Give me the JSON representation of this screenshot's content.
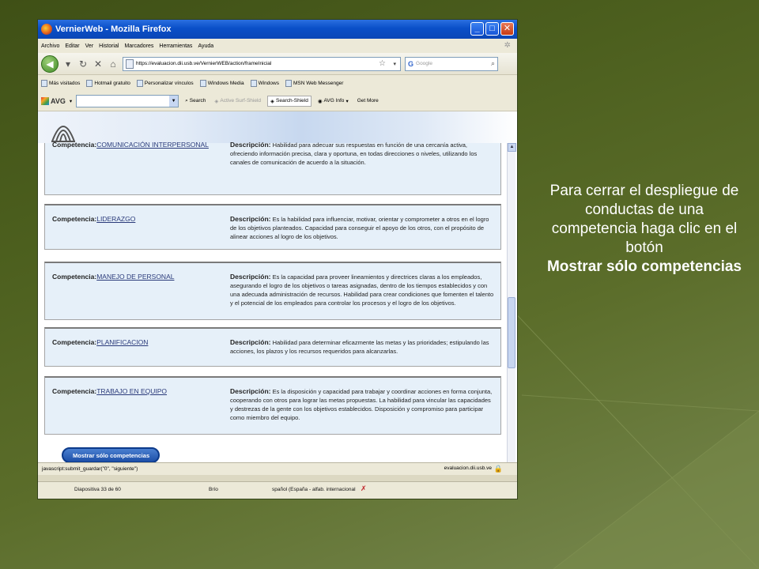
{
  "browser": {
    "title": "VernierWeb - Mozilla Firefox",
    "window_buttons": [
      "_",
      "□",
      "✕"
    ],
    "menu": [
      "Archivo",
      "Editar",
      "Ver",
      "Historial",
      "Marcadores",
      "Herramientas",
      "Ayuda"
    ],
    "url": "https://evaluacion.dii.usb.ve/VernierWEB/action/frameInicial",
    "search_placeholder": "Google",
    "bookmarks": [
      "Más visitados",
      "Hotmail gratuito",
      "Personalizar vínculos",
      "Windows Media",
      "Windows",
      "MSN Web Messenger"
    ],
    "toolbar": {
      "avg_label": "AVG",
      "search_label": "Search",
      "active_surf_label": "Active Surf-Shield",
      "search_shield_label": "Search-Shield",
      "avg_info_label": "AVG Info",
      "get_more_label": "Get More"
    },
    "status_text": "javascript:submit_guardar(\"0\", \"siguiente\")",
    "status_domain": "evaluacion.dii.usb.ve"
  },
  "page": {
    "competency_label": "Competencia:",
    "description_label": "Descripción:",
    "competencies": [
      {
        "name": "COMUNICACIÓN INTERPERSONAL",
        "description": "Habilidad para adecuar sus respuestas en función de una cercanía activa, ofreciendo información precisa, clara y oportuna, en todas direcciones o niveles, utilizando los canales de comunicación de acuerdo a la situación."
      },
      {
        "name": "LIDERAZGO",
        "description": "Es la habilidad para influenciar, motivar, orientar y comprometer a otros en el logro de los objetivos planteados. Capacidad para conseguir el apoyo de los otros, con el propósito de alinear acciones al logro de los objetivos."
      },
      {
        "name": "MANEJO DE PERSONAL",
        "description": "Es la capacidad para proveer lineamientos y directrices claras a los empleados, asegurando el logro de los objetivos o tareas asignadas, dentro de los tiempos establecidos y con una adecuada administración de recursos. Habilidad para crear condiciones que fomenten el talento y el potencial de los empleados para controlar los procesos y el logro de los objetivos."
      },
      {
        "name": "PLANIFICACION",
        "description": "Habilidad para determinar eficazmente las metas y las prioridades; estipulando las acciones, los plazos y los recursos requeridos para alcanzarlas."
      },
      {
        "name": "TRABAJO EN EQUIPO",
        "description": "Es la disposición y capacidad para trabajar y coordinar acciones en forma conjunta, cooperando con otros para lograr las metas propuestas. La habilidad para vincular las capacidades y destrezas de la gente con los objetivos establecidos. Disposición y compromiso para participar como miembro del equipo."
      }
    ],
    "show_only_button": "Mostrar sólo competencias"
  },
  "ppt_status": {
    "slide": "Diapositiva 33 de 60",
    "theme": "Brío",
    "language": "spañol (España - alfab. internacional"
  },
  "instruction": {
    "text": "Para cerrar el despliegue de conductas de una competencia haga clic en el botón",
    "bold": "Mostrar sólo competencias"
  }
}
